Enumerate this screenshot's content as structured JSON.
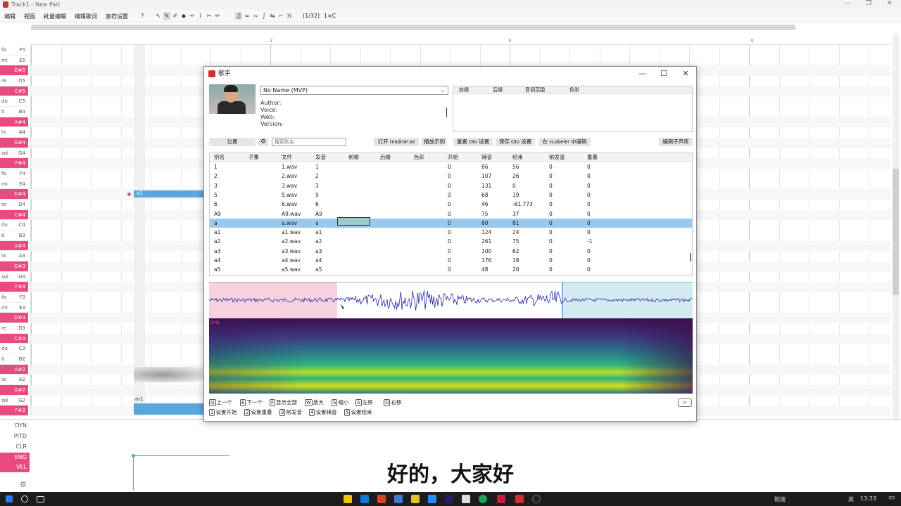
{
  "app": {
    "window_title": "Track1 - New Part",
    "menu": [
      "编辑",
      "视图",
      "批量编辑",
      "编辑歌词",
      "音符设置",
      "?"
    ],
    "tool_position": "(1/32)",
    "tool_extra": "1×C"
  },
  "ruler": {
    "marks": [
      "2",
      "3",
      "4"
    ]
  },
  "piano_keys": [
    {
      "sol": "fa",
      "name": "F5",
      "black": false
    },
    {
      "sol": "mi",
      "name": "E5",
      "black": false
    },
    {
      "sol": "",
      "name": "D#5",
      "black": true
    },
    {
      "sol": "re",
      "name": "D5",
      "black": false
    },
    {
      "sol": "",
      "name": "C#5",
      "black": true
    },
    {
      "sol": "do",
      "name": "C5",
      "black": false
    },
    {
      "sol": "ti",
      "name": "B4",
      "black": false
    },
    {
      "sol": "",
      "name": "A#4",
      "black": true
    },
    {
      "sol": "la",
      "name": "A4",
      "black": false
    },
    {
      "sol": "",
      "name": "G#4",
      "black": true
    },
    {
      "sol": "sol",
      "name": "G4",
      "black": false
    },
    {
      "sol": "",
      "name": "F#4",
      "black": true
    },
    {
      "sol": "fa",
      "name": "F4",
      "black": false
    },
    {
      "sol": "mi",
      "name": "E4",
      "black": false
    },
    {
      "sol": "",
      "name": "D#4",
      "black": true
    },
    {
      "sol": "re",
      "name": "D4",
      "black": false
    },
    {
      "sol": "",
      "name": "C#4",
      "black": true
    },
    {
      "sol": "do",
      "name": "C4",
      "black": false
    },
    {
      "sol": "ti",
      "name": "B3",
      "black": false
    },
    {
      "sol": "",
      "name": "A#3",
      "black": true
    },
    {
      "sol": "la",
      "name": "A3",
      "black": false
    },
    {
      "sol": "",
      "name": "G#3",
      "black": true
    },
    {
      "sol": "sol",
      "name": "G3",
      "black": false
    },
    {
      "sol": "",
      "name": "F#3",
      "black": true
    },
    {
      "sol": "fa",
      "name": "F3",
      "black": false
    },
    {
      "sol": "mi",
      "name": "E3",
      "black": false
    },
    {
      "sol": "",
      "name": "D#3",
      "black": true
    },
    {
      "sol": "re",
      "name": "D3",
      "black": false
    },
    {
      "sol": "",
      "name": "C#3",
      "black": true
    },
    {
      "sol": "do",
      "name": "C3",
      "black": false
    },
    {
      "sol": "ti",
      "name": "B2",
      "black": false
    },
    {
      "sol": "",
      "name": "A#2",
      "black": true
    },
    {
      "sol": "la",
      "name": "A2",
      "black": false
    },
    {
      "sol": "",
      "name": "G#2",
      "black": true
    },
    {
      "sol": "sol",
      "name": "G2",
      "black": false
    },
    {
      "sol": "",
      "name": "F#2",
      "black": true
    }
  ],
  "notes": {
    "note1": "a1",
    "note2": "m1"
  },
  "expressions": [
    {
      "name": "DYN",
      "pink": false
    },
    {
      "name": "PITD",
      "pink": false
    },
    {
      "name": "CLR",
      "pink": false
    },
    {
      "name": "ENG",
      "pink": true
    },
    {
      "name": "VEL",
      "pink": true
    }
  ],
  "subtitle": "好的，大家好",
  "dialog": {
    "title": "歌手",
    "singer": "No Name (MVP)",
    "author_label": "Author:",
    "voice_label": "Voice:",
    "web_label": "Web:",
    "version_label": "Version:",
    "info_headers": [
      "前缀",
      "后缀",
      "音调范围",
      "色彩"
    ],
    "location_button": "位置",
    "search_placeholder": "搜索别名",
    "buttons": {
      "open_readme": "打开 readme.txt",
      "play_sample": "播放示例",
      "reset_oto": "重置 Oto 设置",
      "save_oto": "保存 Oto 设置",
      "vlabeler": "在 vLabeler 中编辑",
      "edit_subbanks": "编辑子声库"
    },
    "columns": [
      "别名",
      "子集",
      "文件",
      "发音",
      "前缀",
      "后缀",
      "色彩",
      "开始",
      "辅音",
      "结束",
      "前发音",
      "重叠"
    ],
    "rows": [
      [
        "1",
        "",
        "1.wav",
        "1",
        "",
        "",
        "",
        "0",
        "86",
        "56",
        "0",
        "0"
      ],
      [
        "2",
        "",
        "2.wav",
        "2",
        "",
        "",
        "",
        "0",
        "107",
        "26",
        "0",
        "0"
      ],
      [
        "3",
        "",
        "3.wav",
        "3",
        "",
        "",
        "",
        "0",
        "131",
        "0",
        "0",
        "0"
      ],
      [
        "5",
        "",
        "5.wav",
        "5",
        "",
        "",
        "",
        "0",
        "68",
        "19",
        "0",
        "0"
      ],
      [
        "6",
        "",
        "6.wav",
        "6",
        "",
        "",
        "",
        "0",
        "46",
        "-61.773",
        "0",
        "0"
      ],
      [
        "A9",
        "",
        "A9.wav",
        "A9",
        "",
        "",
        "",
        "0",
        "75",
        "37",
        "0",
        "0"
      ],
      [
        "a",
        "",
        "a.wav",
        "a",
        "",
        "",
        "",
        "0",
        "80",
        "81",
        "0",
        "0"
      ],
      [
        "a1",
        "",
        "a1.wav",
        "a1",
        "",
        "",
        "",
        "0",
        "124",
        "24",
        "0",
        "0"
      ],
      [
        "a2",
        "",
        "a2.wav",
        "a2",
        "",
        "",
        "",
        "0",
        "261",
        "75",
        "0",
        "-1"
      ],
      [
        "a3",
        "",
        "a3.wav",
        "a3",
        "",
        "",
        "",
        "0",
        "100",
        "62",
        "0",
        "0"
      ],
      [
        "a4",
        "",
        "a4.wav",
        "a4",
        "",
        "",
        "",
        "0",
        "176",
        "18",
        "0",
        "0"
      ],
      [
        "a5",
        "",
        "a5.wav",
        "a5",
        "",
        "",
        "",
        "0",
        "48",
        "20",
        "0",
        "0"
      ]
    ],
    "selected_row": 6,
    "spectrogram_label": "DYN",
    "shortcuts_row1": [
      {
        "key": "Q",
        "label": "上一个"
      },
      {
        "key": "E",
        "label": "下一个"
      },
      {
        "key": "F",
        "label": "显示全部"
      },
      {
        "key": "W",
        "label": "放大"
      },
      {
        "key": "S",
        "label": "缩小"
      },
      {
        "key": "A",
        "label": "左移"
      },
      {
        "key": "D",
        "label": "右移"
      }
    ],
    "shortcuts_row2": [
      {
        "key": "1",
        "label": "设置开始"
      },
      {
        "key": "2",
        "label": "设置重叠"
      },
      {
        "key": "3",
        "label": "前发音"
      },
      {
        "key": "4",
        "label": "设置辅音"
      },
      {
        "key": "5",
        "label": "设置结束"
      }
    ]
  },
  "taskbar": {
    "lang": "英",
    "time": "13:33",
    "tray_text": "链接"
  }
}
